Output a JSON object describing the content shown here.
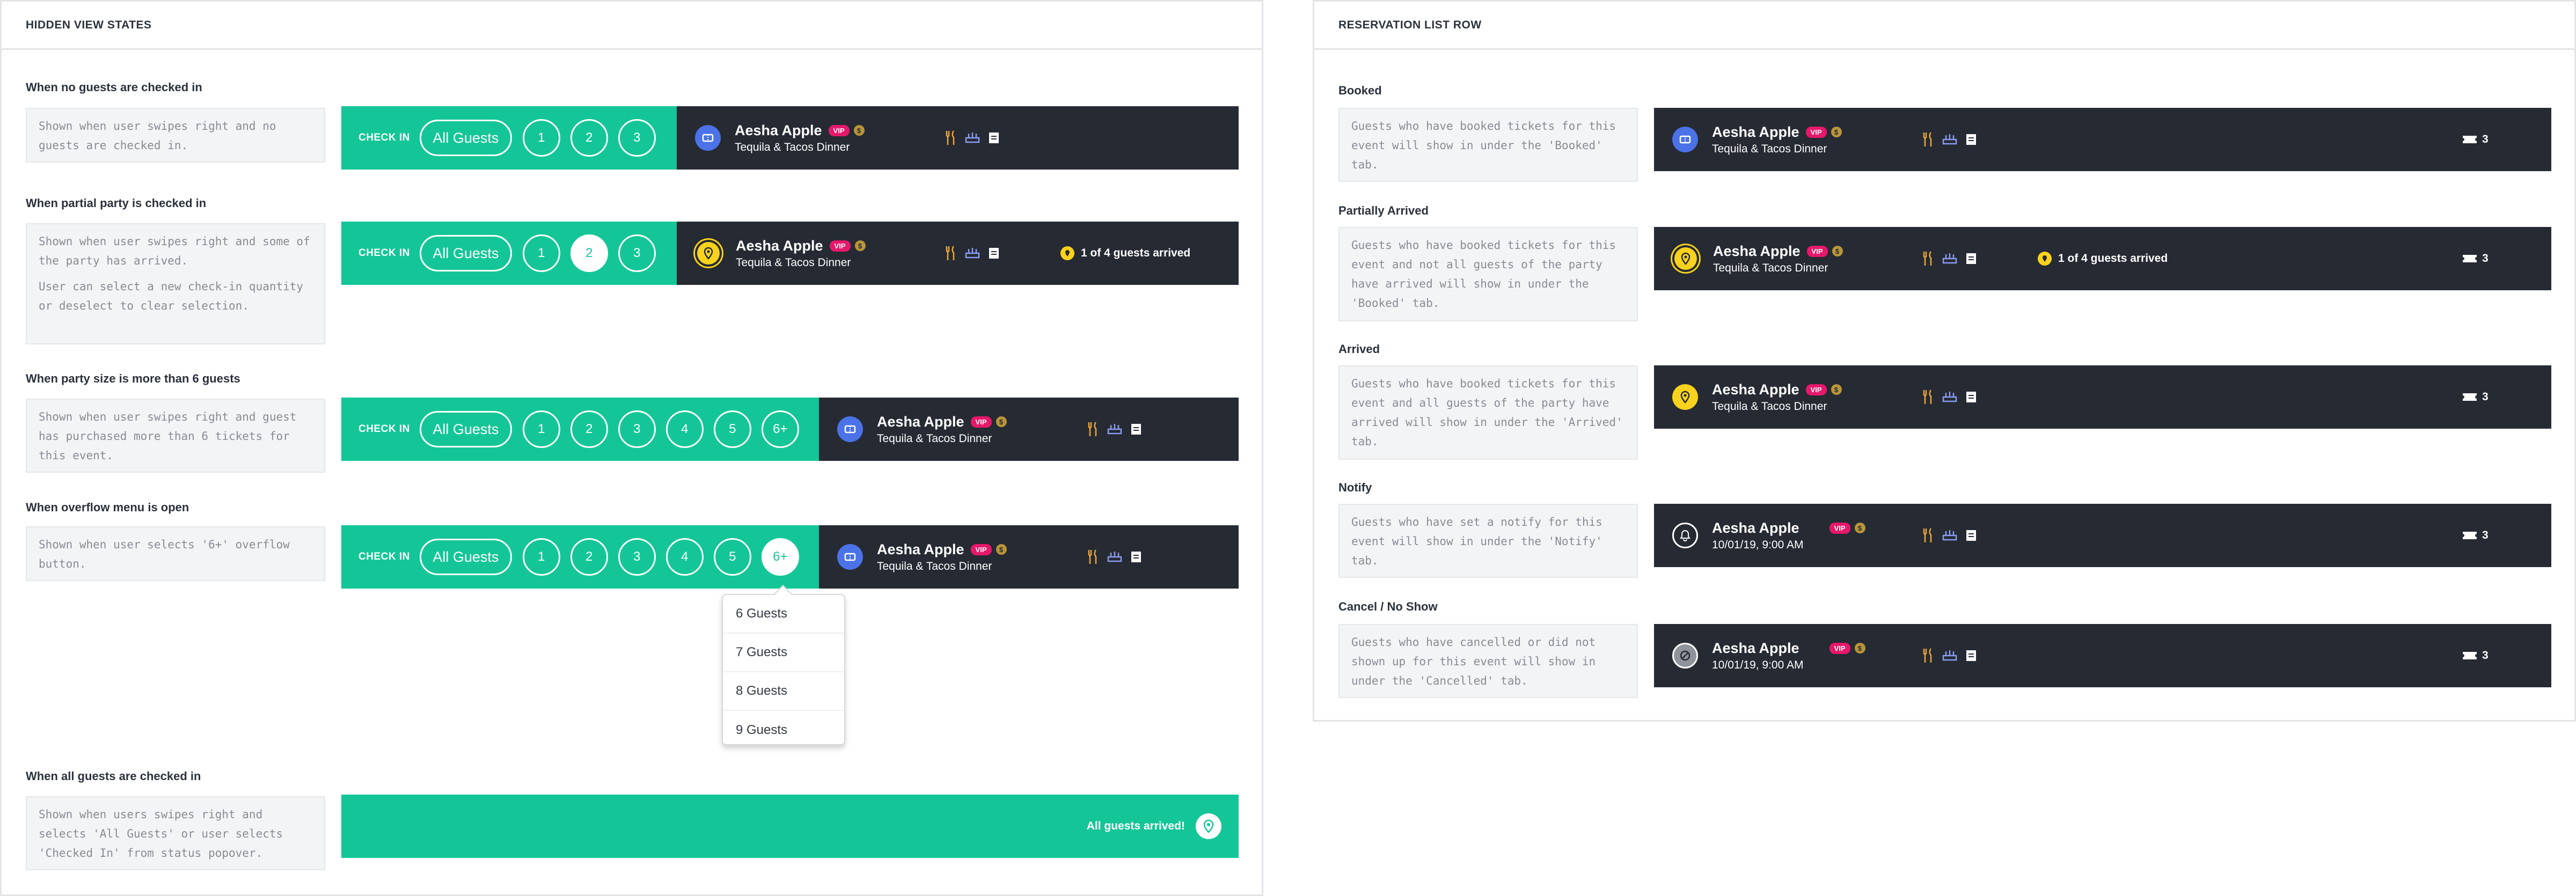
{
  "left_panel": {
    "title": "HIDDEN VIEW STATES",
    "sections": [
      {
        "label": "When no guests are checked in",
        "description": [
          "Shown when user swipes right and no guests are checked in."
        ],
        "checkin_label": "CHECK IN",
        "all_guests": "All Guests",
        "buttons": [
          "1",
          "2",
          "3"
        ],
        "selected": null,
        "guest_name": "Aesha Apple",
        "vip": "VIP",
        "dollar": "$",
        "event": "Tequila & Tacos Dinner"
      },
      {
        "label": "When partial party is checked in",
        "description": [
          "Shown when user swipes right and some of the party has arrived.",
          "User can select a new check-in quantity or deselect to clear selection."
        ],
        "checkin_label": "CHECK IN",
        "all_guests": "All Guests",
        "buttons": [
          "1",
          "2",
          "3"
        ],
        "selected": "2",
        "guest_name": "Aesha Apple",
        "vip": "VIP",
        "dollar": "$",
        "event": "Tequila & Tacos Dinner",
        "status": "1 of 4 guests arrived"
      },
      {
        "label": "When party size is more than 6 guests",
        "description": [
          "Shown when user swipes right and guest has purchased more than 6 tickets for this event."
        ],
        "checkin_label": "CHECK IN",
        "all_guests": "All Guests",
        "buttons": [
          "1",
          "2",
          "3",
          "4",
          "5",
          "6+"
        ],
        "selected": null,
        "guest_name": "Aesha Apple",
        "vip": "VIP",
        "dollar": "$",
        "event": "Tequila & Tacos Dinner"
      },
      {
        "label": "When overflow menu is open",
        "description": [
          "Shown when user selects '6+' overflow button."
        ],
        "checkin_label": "CHECK IN",
        "all_guests": "All Guests",
        "buttons": [
          "1",
          "2",
          "3",
          "4",
          "5",
          "6+"
        ],
        "selected": "6+",
        "guest_name": "Aesha Apple",
        "vip": "VIP",
        "dollar": "$",
        "event": "Tequila & Tacos Dinner",
        "overflow_options": [
          "6 Guests",
          "7 Guests",
          "8 Guests",
          "9 Guests"
        ]
      },
      {
        "label": "When all guests are checked in",
        "description": [
          "Shown when users swipes right and selects 'All Guests' or user selects 'Checked In' from status popover."
        ],
        "all_arrived_text": "All guests arrived!"
      }
    ]
  },
  "right_panel": {
    "title": "RESERVATION LIST ROW",
    "rows": [
      {
        "label": "Booked",
        "description": "Guests who have booked tickets for this event will show in under the 'Booked' tab.",
        "avatar": "ticket-icon",
        "guest_name": "Aesha Apple",
        "vip": "VIP",
        "dollar": "$",
        "subtitle": "Tequila & Tacos Dinner",
        "ticket_count": "3"
      },
      {
        "label": "Partially Arrived",
        "description": "Guests who have booked tickets for this event and not all guests of the party have arrived will show in under the 'Booked' tab.",
        "avatar": "pin-icon",
        "guest_name": "Aesha Apple",
        "vip": "VIP",
        "dollar": "$",
        "subtitle": "Tequila & Tacos Dinner",
        "status": "1 of 4 guests arrived",
        "ticket_count": "3"
      },
      {
        "label": "Arrived",
        "description": "Guests who have booked tickets for this event and all guests of the party have arrived will show in under the 'Arrived' tab.",
        "avatar": "pin-icon",
        "guest_name": "Aesha Apple",
        "vip": "VIP",
        "dollar": "$",
        "subtitle": "Tequila & Tacos Dinner",
        "ticket_count": "3"
      },
      {
        "label": "Notify",
        "description": "Guests who have set a notify for this event will show in under the 'Notify' tab.",
        "avatar": "bell-icon",
        "guest_name": "Aesha Apple",
        "vip": "VIP",
        "dollar": "$",
        "subtitle": "10/01/19, 9:00 AM",
        "ticket_count": "3"
      },
      {
        "label": "Cancel / No Show",
        "description": "Guests who have cancelled or did not shown up for this event will show in under the 'Cancelled' tab.",
        "avatar": "cancel-icon",
        "guest_name": "Aesha Apple",
        "vip": "VIP",
        "dollar": "$",
        "subtitle": "10/01/19, 9:00 AM",
        "ticket_count": "3"
      }
    ]
  },
  "colors": {
    "green": "#14c697",
    "dark": "#262a33",
    "vip_pink": "#e6186b",
    "dollar_gold": "#b8953a",
    "status_yellow": "#f8d21c",
    "avatar_blue": "#4b72e6",
    "food_icon": "#f0a93a",
    "seat_icon": "#8a9cf0"
  }
}
